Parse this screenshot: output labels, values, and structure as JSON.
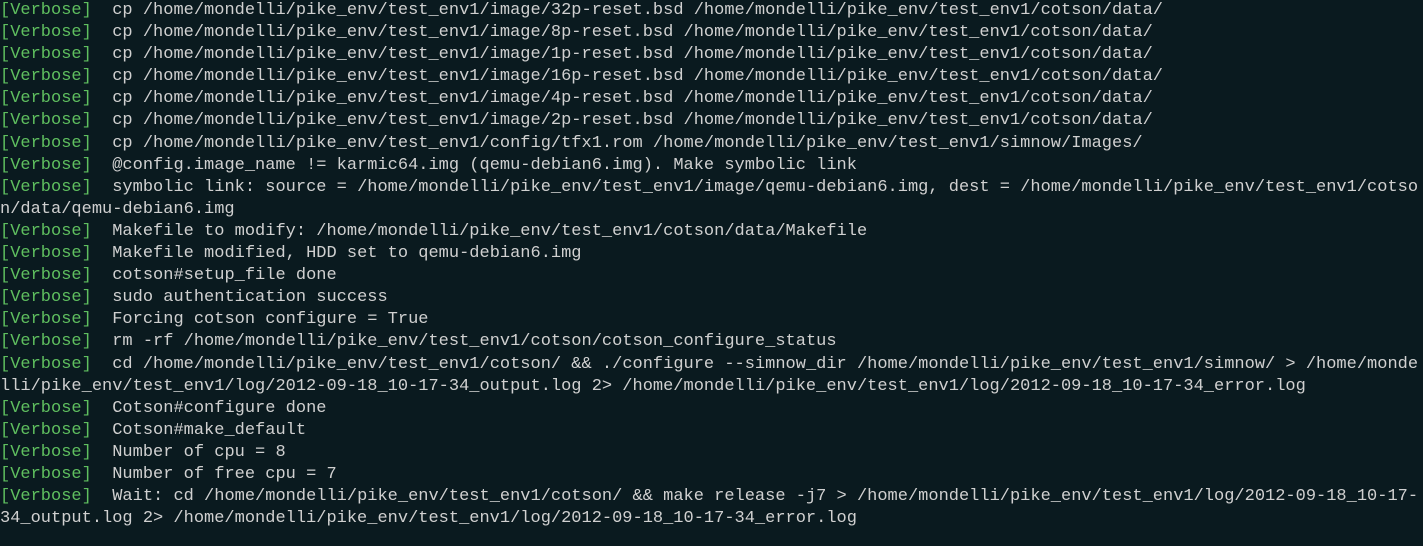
{
  "lines": [
    {
      "tag": "[Verbose]",
      "text": "  cp /home/mondelli/pike_env/test_env1/image/32p-reset.bsd /home/mondelli/pike_env/test_env1/cotson/data/"
    },
    {
      "tag": "[Verbose]",
      "text": "  cp /home/mondelli/pike_env/test_env1/image/8p-reset.bsd /home/mondelli/pike_env/test_env1/cotson/data/"
    },
    {
      "tag": "[Verbose]",
      "text": "  cp /home/mondelli/pike_env/test_env1/image/1p-reset.bsd /home/mondelli/pike_env/test_env1/cotson/data/"
    },
    {
      "tag": "[Verbose]",
      "text": "  cp /home/mondelli/pike_env/test_env1/image/16p-reset.bsd /home/mondelli/pike_env/test_env1/cotson/data/"
    },
    {
      "tag": "[Verbose]",
      "text": "  cp /home/mondelli/pike_env/test_env1/image/4p-reset.bsd /home/mondelli/pike_env/test_env1/cotson/data/"
    },
    {
      "tag": "[Verbose]",
      "text": "  cp /home/mondelli/pike_env/test_env1/image/2p-reset.bsd /home/mondelli/pike_env/test_env1/cotson/data/"
    },
    {
      "tag": "[Verbose]",
      "text": "  cp /home/mondelli/pike_env/test_env1/config/tfx1.rom /home/mondelli/pike_env/test_env1/simnow/Images/"
    },
    {
      "tag": "[Verbose]",
      "text": "  @config.image_name != karmic64.img (qemu-debian6.img). Make symbolic link"
    },
    {
      "tag": "[Verbose]",
      "text": "  symbolic link: source = /home/mondelli/pike_env/test_env1/image/qemu-debian6.img, dest = /home/mondelli/pike_env/test_env1/cotson/data/qemu-debian6.img"
    },
    {
      "tag": "[Verbose]",
      "text": "  Makefile to modify: /home/mondelli/pike_env/test_env1/cotson/data/Makefile"
    },
    {
      "tag": "[Verbose]",
      "text": "  Makefile modified, HDD set to qemu-debian6.img"
    },
    {
      "tag": "[Verbose]",
      "text": "  cotson#setup_file done"
    },
    {
      "tag": "[Verbose]",
      "text": "  sudo authentication success"
    },
    {
      "tag": "[Verbose]",
      "text": "  Forcing cotson configure = True"
    },
    {
      "tag": "[Verbose]",
      "text": "  rm -rf /home/mondelli/pike_env/test_env1/cotson/cotson_configure_status"
    },
    {
      "tag": "[Verbose]",
      "text": "  cd /home/mondelli/pike_env/test_env1/cotson/ && ./configure --simnow_dir /home/mondelli/pike_env/test_env1/simnow/ > /home/mondelli/pike_env/test_env1/log/2012-09-18_10-17-34_output.log 2> /home/mondelli/pike_env/test_env1/log/2012-09-18_10-17-34_error.log"
    },
    {
      "tag": "[Verbose]",
      "text": "  Cotson#configure done"
    },
    {
      "tag": "[Verbose]",
      "text": "  Cotson#make_default"
    },
    {
      "tag": "[Verbose]",
      "text": "  Number of cpu = 8"
    },
    {
      "tag": "[Verbose]",
      "text": "  Number of free cpu = 7"
    },
    {
      "tag": "[Verbose]",
      "text": "  Wait: cd /home/mondelli/pike_env/test_env1/cotson/ && make release -j7 > /home/mondelli/pike_env/test_env1/log/2012-09-18_10-17-34_output.log 2> /home/mondelli/pike_env/test_env1/log/2012-09-18_10-17-34_error.log"
    }
  ]
}
